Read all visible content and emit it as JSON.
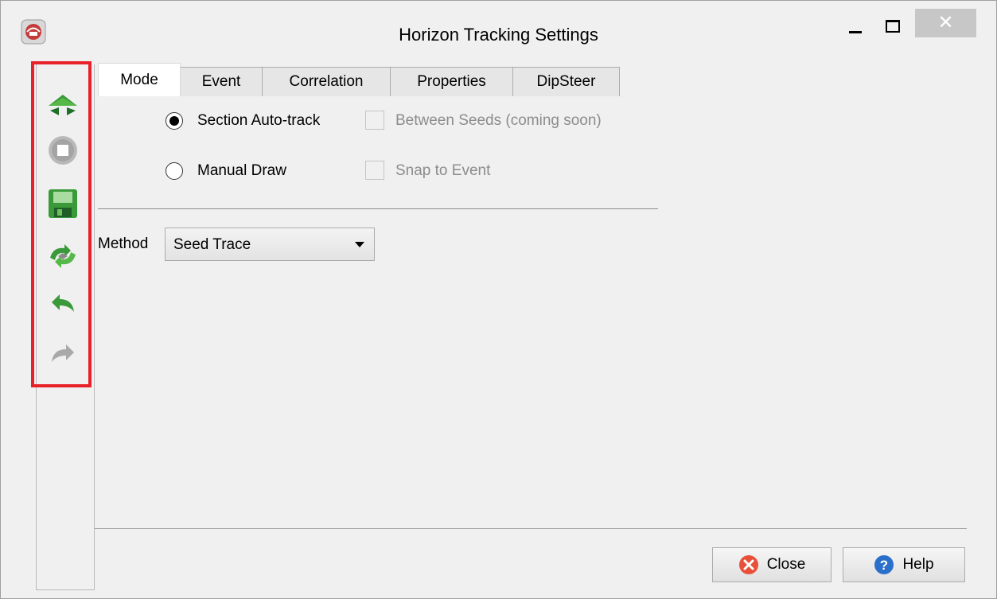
{
  "window": {
    "title": "Horizon Tracking Settings",
    "close_glyph": "✕",
    "app_icon": "opendtect-logo-icon"
  },
  "toolbar": {
    "highlight_color": "#e8202a",
    "items": [
      {
        "name": "start-tracking-icon",
        "enabled": true
      },
      {
        "name": "stop-icon",
        "enabled": false
      },
      {
        "name": "save-icon",
        "enabled": true
      },
      {
        "name": "retrack-icon",
        "enabled": true
      },
      {
        "name": "undo-icon",
        "enabled": true
      },
      {
        "name": "redo-icon",
        "enabled": false
      }
    ]
  },
  "tabs": [
    {
      "label": "Mode",
      "active": true
    },
    {
      "label": "Event",
      "active": false
    },
    {
      "label": "Correlation",
      "active": false
    },
    {
      "label": "Properties",
      "active": false
    },
    {
      "label": "DipSteer",
      "active": false
    }
  ],
  "mode": {
    "section_autotrack": {
      "label": "Section Auto-track",
      "selected": true
    },
    "between_seeds": {
      "label": "Between Seeds (coming soon)",
      "checked": false,
      "enabled": false
    },
    "manual_draw": {
      "label": "Manual Draw",
      "selected": false
    },
    "snap_to_event": {
      "label": "Snap to Event",
      "checked": false,
      "enabled": false
    }
  },
  "method": {
    "label": "Method",
    "value": "Seed Trace"
  },
  "buttons": {
    "close": "Close",
    "help": "Help"
  },
  "colors": {
    "accent_green": "#3a9a3a",
    "close_red": "#e8503a",
    "help_blue": "#2a6fc9"
  }
}
